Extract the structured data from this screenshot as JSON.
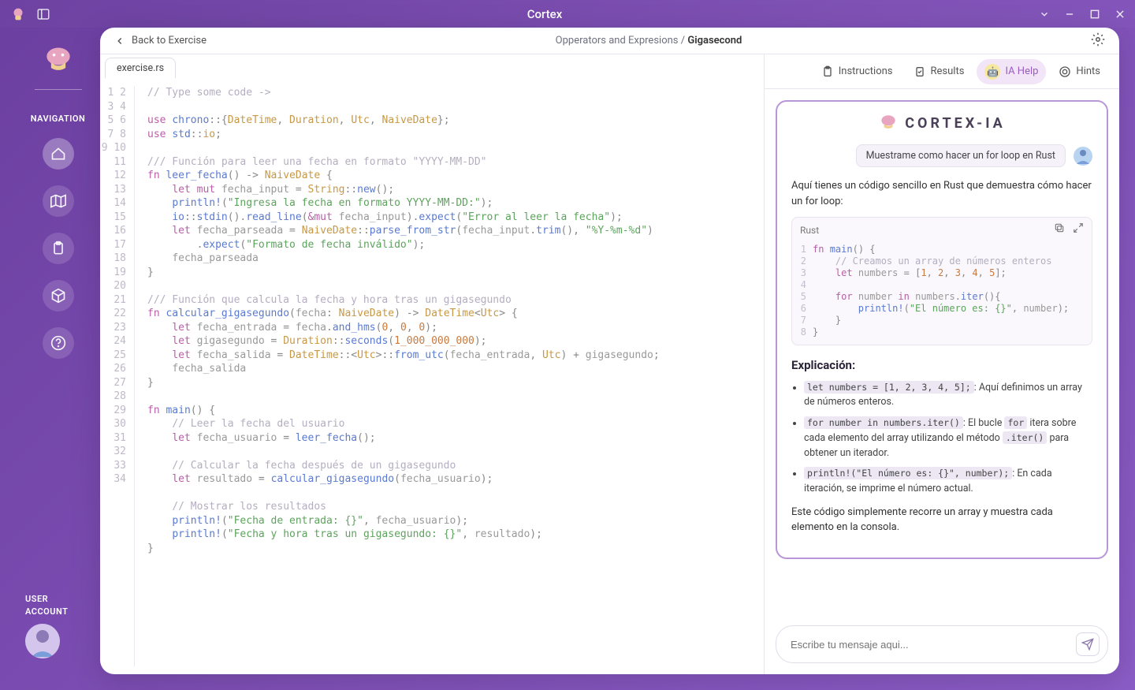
{
  "app_title": "Cortex",
  "back_label": "Back to Exercise",
  "breadcrumb_section": "Opperators and Expresions",
  "breadcrumb_page": "Gigasecond",
  "file_tab": "exercise.rs",
  "nav": {
    "title": "NAVIGATION",
    "user_title": "USER\nACCOUNT"
  },
  "tabs": {
    "instructions": "Instructions",
    "results": "Results",
    "iahelp": "IA Help",
    "hints": "Hints"
  },
  "ai": {
    "brand": "CORTEX-IA",
    "user_message": "Muestrame como hacer un for  loop en Rust",
    "intro": "Aquí tienes un código sencillo en Rust que demuestra cómo hacer un for loop:",
    "code_lang": "Rust",
    "explain_title": "Explicación:",
    "b1_code": "let numbers = [1, 2, 3, 4, 5];",
    "b1_text": ": Aquí definimos un array de números enteros.",
    "b2_code1": "for number in numbers.iter()",
    "b2_text1": ": El bucle ",
    "b2_code2": "for",
    "b2_text2": " itera sobre cada elemento del array utilizando el método ",
    "b2_code3": ".iter()",
    "b2_text3": " para obtener un iterador.",
    "b3_code": "println!(\"El número es: {}\", number);",
    "b3_text": ": En cada iteración, se imprime el número actual.",
    "outro": "Este código simplemente recorre un array y muestra cada elemento en la consola."
  },
  "composer_placeholder": "Escribe tu mensaje aqui...",
  "editor_lines": [
    {
      "n": 1,
      "h": "<span class='tk-comm'>// Type some code -&gt;</span>"
    },
    {
      "n": 2,
      "h": ""
    },
    {
      "n": 3,
      "h": "<span class='tk-kw'>use</span> <span class='tk-fn'>chrono</span><span class='tk-punc'>::{</span><span class='tk-type'>DateTime</span><span class='tk-punc'>, </span><span class='tk-type'>Duration</span><span class='tk-punc'>, </span><span class='tk-type'>Utc</span><span class='tk-punc'>, </span><span class='tk-type'>NaiveDate</span><span class='tk-punc'>};</span>"
    },
    {
      "n": 4,
      "h": "<span class='tk-kw'>use</span> <span class='tk-fn'>std</span><span class='tk-punc'>::</span><span class='tk-type'>io</span><span class='tk-punc'>;</span>"
    },
    {
      "n": 5,
      "h": ""
    },
    {
      "n": 6,
      "h": "<span class='tk-comm'>/// Función para leer una fecha en formato \"YYYY-MM-DD\"</span>"
    },
    {
      "n": 7,
      "h": "<span class='tk-kw'>fn</span> <span class='tk-fn'>leer_fecha</span><span class='tk-punc'>() -&gt; </span><span class='tk-type'>NaiveDate</span><span class='tk-punc'> {</span>"
    },
    {
      "n": 8,
      "h": "    <span class='tk-kw'>let mut</span> <span class='tk-ident'>fecha_input</span> <span class='tk-punc'>= </span><span class='tk-type'>String</span><span class='tk-punc'>::</span><span class='tk-fn'>new</span><span class='tk-punc'>();</span>"
    },
    {
      "n": 9,
      "h": "    <span class='tk-fn'>println!</span><span class='tk-punc'>(</span><span class='tk-str'>\"Ingresa la fecha en formato YYYY-MM-DD:\"</span><span class='tk-punc'>);</span>"
    },
    {
      "n": 10,
      "h": "    <span class='tk-fn'>io</span><span class='tk-punc'>::</span><span class='tk-fn'>stdin</span><span class='tk-punc'>().</span><span class='tk-fn'>read_line</span><span class='tk-punc'>(</span><span class='tk-kw'>&amp;mut</span> <span class='tk-ident'>fecha_input</span><span class='tk-punc'>).</span><span class='tk-fn'>expect</span><span class='tk-punc'>(</span><span class='tk-str'>\"Error al leer la fecha\"</span><span class='tk-punc'>);</span>"
    },
    {
      "n": 11,
      "h": "    <span class='tk-kw'>let</span> <span class='tk-ident'>fecha_parseada</span> <span class='tk-punc'>= </span><span class='tk-type'>NaiveDate</span><span class='tk-punc'>::</span><span class='tk-fn'>parse_from_str</span><span class='tk-punc'>(</span><span class='tk-ident'>fecha_input</span><span class='tk-punc'>.</span><span class='tk-fn'>trim</span><span class='tk-punc'>(), </span><span class='tk-str'>\"%Y-%m-%d\"</span><span class='tk-punc'>)</span>"
    },
    {
      "n": 12,
      "h": "        <span class='tk-punc'>.</span><span class='tk-fn'>expect</span><span class='tk-punc'>(</span><span class='tk-str'>\"Formato de fecha inválido\"</span><span class='tk-punc'>);</span>"
    },
    {
      "n": 13,
      "h": "    <span class='tk-ident'>fecha_parseada</span>"
    },
    {
      "n": 14,
      "h": "<span class='tk-punc'>}</span>"
    },
    {
      "n": 15,
      "h": ""
    },
    {
      "n": 16,
      "h": "<span class='tk-comm'>/// Función que calcula la fecha y hora tras un gigasegundo</span>"
    },
    {
      "n": 17,
      "h": "<span class='tk-kw'>fn</span> <span class='tk-fn'>calcular_gigasegundo</span><span class='tk-punc'>(</span><span class='tk-ident'>fecha</span><span class='tk-punc'>: </span><span class='tk-type'>NaiveDate</span><span class='tk-punc'>) -&gt; </span><span class='tk-type'>DateTime</span><span class='tk-punc'>&lt;</span><span class='tk-type'>Utc</span><span class='tk-punc'>&gt; {</span>"
    },
    {
      "n": 18,
      "h": "    <span class='tk-kw'>let</span> <span class='tk-ident'>fecha_entrada</span> <span class='tk-punc'>= </span><span class='tk-ident'>fecha</span><span class='tk-punc'>.</span><span class='tk-fn'>and_hms</span><span class='tk-punc'>(</span><span class='tk-num'>0</span><span class='tk-punc'>, </span><span class='tk-num'>0</span><span class='tk-punc'>, </span><span class='tk-num'>0</span><span class='tk-punc'>);</span>"
    },
    {
      "n": 19,
      "h": "    <span class='tk-kw'>let</span> <span class='tk-ident'>gigasegundo</span> <span class='tk-punc'>= </span><span class='tk-type'>Duration</span><span class='tk-punc'>::</span><span class='tk-fn'>seconds</span><span class='tk-punc'>(</span><span class='tk-num'>1_000_000_000</span><span class='tk-punc'>);</span>"
    },
    {
      "n": 20,
      "h": "    <span class='tk-kw'>let</span> <span class='tk-ident'>fecha_salida</span> <span class='tk-punc'>= </span><span class='tk-type'>DateTime</span><span class='tk-punc'>::&lt;</span><span class='tk-type'>Utc</span><span class='tk-punc'>&gt;::</span><span class='tk-fn'>from_utc</span><span class='tk-punc'>(</span><span class='tk-ident'>fecha_entrada</span><span class='tk-punc'>, </span><span class='tk-type'>Utc</span><span class='tk-punc'>) + </span><span class='tk-ident'>gigasegundo</span><span class='tk-punc'>;</span>"
    },
    {
      "n": 21,
      "h": "    <span class='tk-ident'>fecha_salida</span>"
    },
    {
      "n": 22,
      "h": "<span class='tk-punc'>}</span>"
    },
    {
      "n": 23,
      "h": ""
    },
    {
      "n": 24,
      "h": "<span class='tk-kw'>fn</span> <span class='tk-fn'>main</span><span class='tk-punc'>() {</span>"
    },
    {
      "n": 25,
      "h": "    <span class='tk-comm'>// Leer la fecha del usuario</span>"
    },
    {
      "n": 26,
      "h": "    <span class='tk-kw'>let</span> <span class='tk-ident'>fecha_usuario</span> <span class='tk-punc'>= </span><span class='tk-fn'>leer_fecha</span><span class='tk-punc'>();</span>"
    },
    {
      "n": 27,
      "h": ""
    },
    {
      "n": 28,
      "h": "    <span class='tk-comm'>// Calcular la fecha después de un gigasegundo</span>"
    },
    {
      "n": 29,
      "h": "    <span class='tk-kw'>let</span> <span class='tk-ident'>resultado</span> <span class='tk-punc'>= </span><span class='tk-fn'>calcular_gigasegundo</span><span class='tk-punc'>(</span><span class='tk-ident'>fecha_usuario</span><span class='tk-punc'>);</span>"
    },
    {
      "n": 30,
      "h": ""
    },
    {
      "n": 31,
      "h": "    <span class='tk-comm'>// Mostrar los resultados</span>"
    },
    {
      "n": 32,
      "h": "    <span class='tk-fn'>println!</span><span class='tk-punc'>(</span><span class='tk-str'>\"Fecha de entrada: {}\"</span><span class='tk-punc'>, </span><span class='tk-ident'>fecha_usuario</span><span class='tk-punc'>);</span>"
    },
    {
      "n": 33,
      "h": "    <span class='tk-fn'>println!</span><span class='tk-punc'>(</span><span class='tk-str'>\"Fecha y hora tras un gigasegundo: {}\"</span><span class='tk-punc'>, </span><span class='tk-ident'>resultado</span><span class='tk-punc'>);</span>"
    },
    {
      "n": 34,
      "h": "<span class='tk-punc'>}</span>"
    }
  ],
  "ai_code_lines": [
    {
      "n": 1,
      "h": "<span class='tk-kw'>fn</span> <span class='tk-fn'>main</span><span class='tk-punc'>() {</span>"
    },
    {
      "n": 2,
      "h": "    <span class='tk-comm'>// Creamos un array de números enteros</span>"
    },
    {
      "n": 3,
      "h": "    <span class='tk-kw'>let</span> <span class='tk-ident'>numbers</span> <span class='tk-punc'>= [</span><span class='tk-num'>1</span><span class='tk-punc'>, </span><span class='tk-num'>2</span><span class='tk-punc'>, </span><span class='tk-num'>3</span><span class='tk-punc'>, </span><span class='tk-num'>4</span><span class='tk-punc'>, </span><span class='tk-num'>5</span><span class='tk-punc'>];</span>"
    },
    {
      "n": 4,
      "h": ""
    },
    {
      "n": 5,
      "h": "    <span class='tk-kw'>for</span> <span class='tk-ident'>number</span> <span class='tk-kw'>in</span> <span class='tk-ident'>numbers</span><span class='tk-punc'>.</span><span class='tk-fn'>iter</span><span class='tk-punc'>(){</span>"
    },
    {
      "n": 6,
      "h": "        <span class='tk-fn'>println!</span><span class='tk-punc'>(</span><span class='tk-str'>\"El número es: {}\"</span><span class='tk-punc'>, </span><span class='tk-ident'>number</span><span class='tk-punc'>);</span>"
    },
    {
      "n": 7,
      "h": "    <span class='tk-punc'>}</span>"
    },
    {
      "n": 8,
      "h": "<span class='tk-punc'>}</span>"
    }
  ]
}
